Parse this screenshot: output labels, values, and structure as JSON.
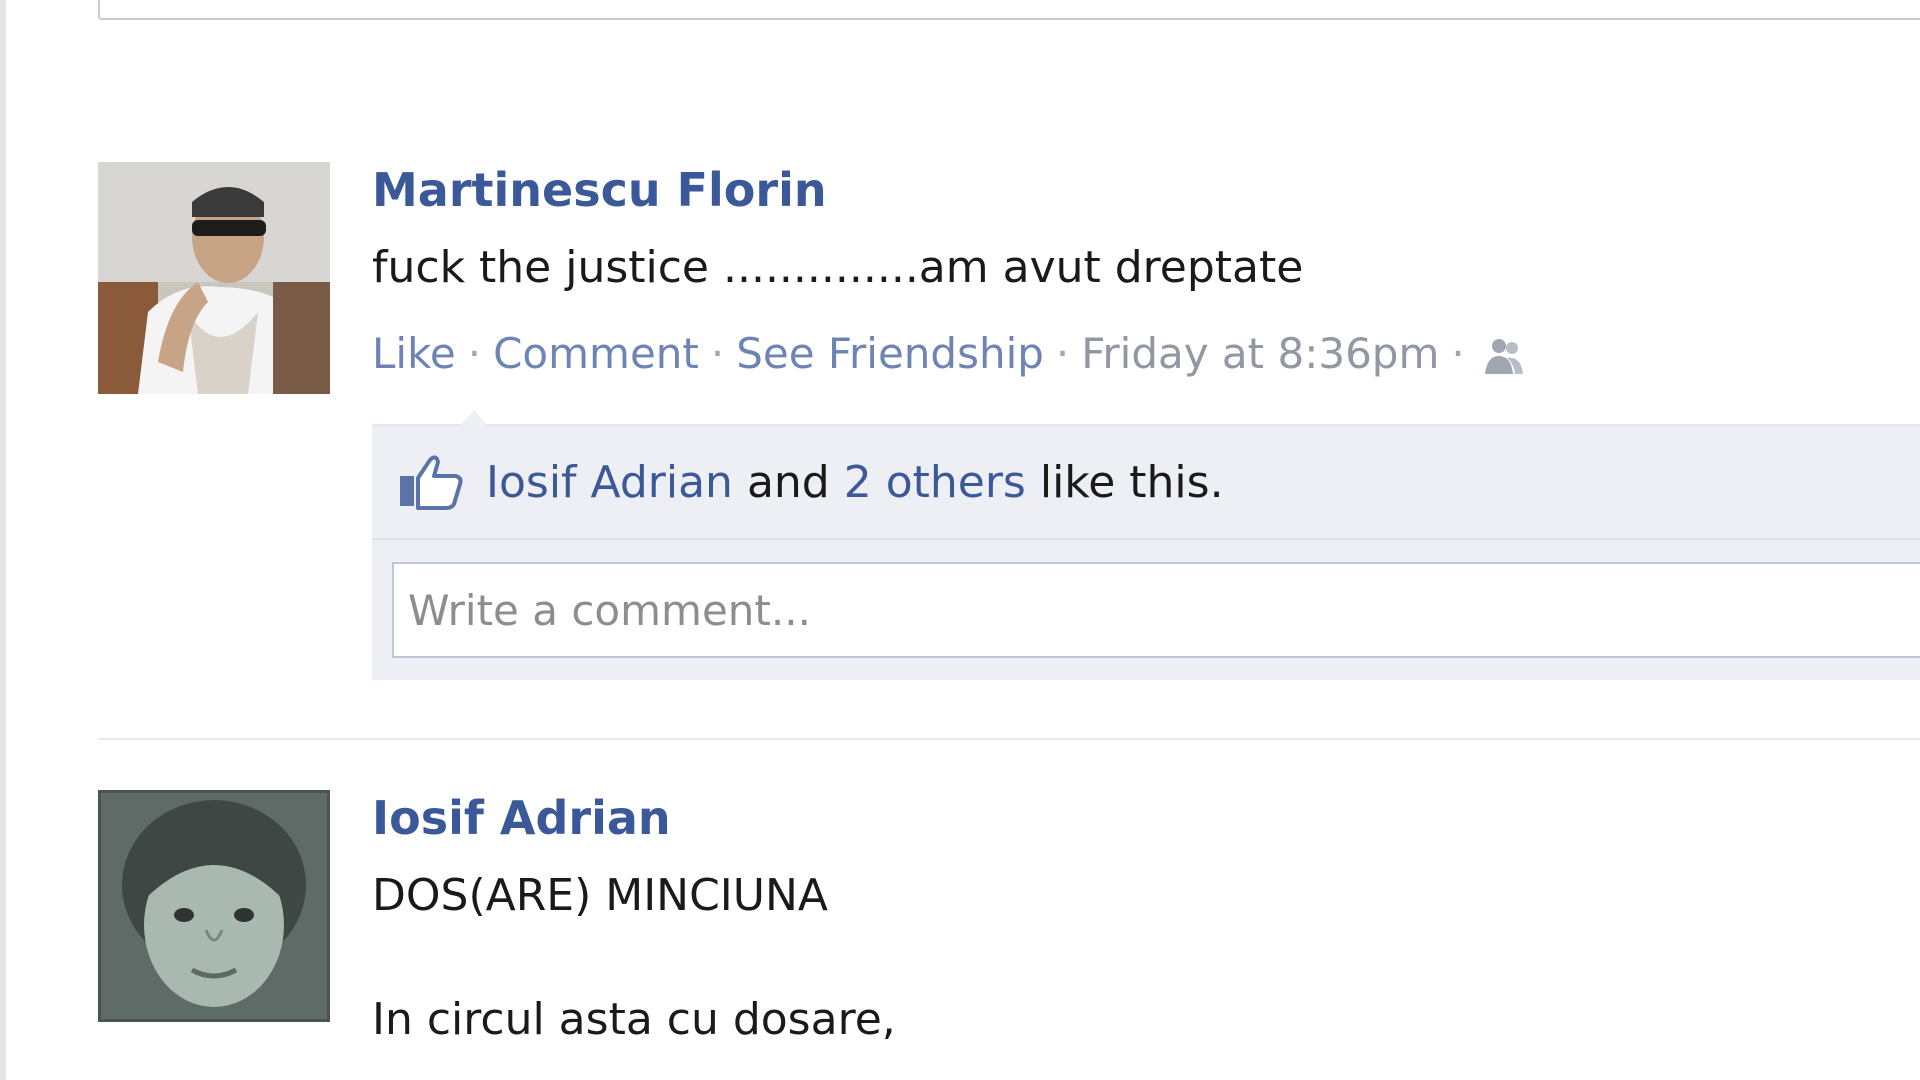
{
  "posts": [
    {
      "author": "Martinescu Florin",
      "message": "fuck the justice ..............am avut dreptate",
      "actions": {
        "like": "Like",
        "comment": "Comment",
        "see_friendship": "See Friendship",
        "timestamp": "Friday at 8:36pm",
        "separator": "·"
      },
      "likes": {
        "name": "Iosif Adrian",
        "and": "and",
        "others": "2 others",
        "suffix": "like this."
      },
      "comment_placeholder": "Write a comment...",
      "friends_icon": "friends-icon",
      "like_icon": "thumbs-up-icon"
    },
    {
      "author": "Iosif Adrian",
      "message": "DOS(ARE) MINCIUNA",
      "poem_line_1": "In circul asta cu dosare,"
    }
  ],
  "colors": {
    "link_blue": "#3b5998",
    "action_link": "#6d84b4",
    "ufi_bg": "#edeff4"
  }
}
